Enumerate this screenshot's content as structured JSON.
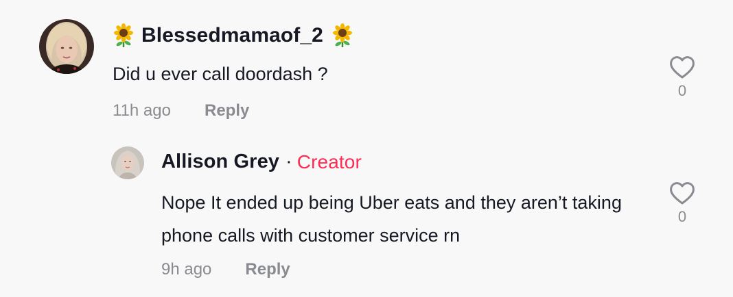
{
  "comments": [
    {
      "username": "Blessedmamaof_2",
      "username_emoji": "sunflower-icon",
      "text": "Did u ever call doordash ?",
      "time": "11h ago",
      "reply_label": "Reply",
      "likes": "0"
    },
    {
      "username": "Allison Grey",
      "separator": "·",
      "badge": "Creator",
      "text": "Nope It ended up being Uber eats and they aren’t taking phone calls with customer service rn",
      "time": "9h ago",
      "reply_label": "Reply",
      "likes": "0"
    }
  ],
  "colors": {
    "background": "#f8f8f8",
    "text_primary": "#161823",
    "text_secondary": "#8a8b91",
    "creator_badge": "#fe2c55"
  }
}
